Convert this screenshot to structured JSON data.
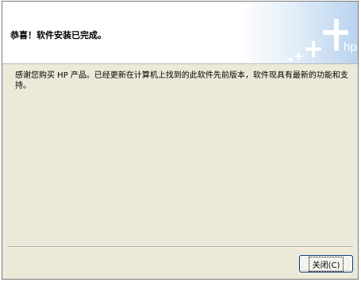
{
  "dialog": {
    "title": "恭喜！软件安装已完成。",
    "message": "感谢您购买 HP 产品。已经更新在计算机上找到的此软件先前版本，软件现具有最新的功能和支持。",
    "close_label": "关闭(C)"
  },
  "banner": {
    "logo_text": "hp",
    "icon": "hp-plus-logo-icon",
    "accent_color": "#bcd6ef"
  }
}
